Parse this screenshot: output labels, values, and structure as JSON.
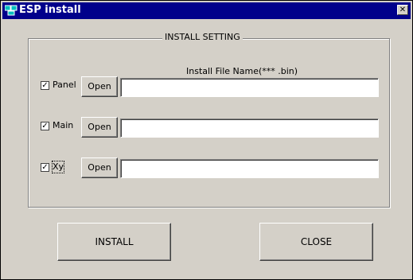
{
  "window": {
    "title": "ESP install"
  },
  "group": {
    "title": "INSTALL SETTING"
  },
  "column_header": "Install File Name(*** .bin)",
  "rows": [
    {
      "label": "Panel",
      "checked": true,
      "open_label": "Open",
      "value": ""
    },
    {
      "label": "Main",
      "checked": true,
      "open_label": "Open",
      "value": ""
    },
    {
      "label": "Xy",
      "checked": true,
      "open_label": "Open",
      "value": ""
    }
  ],
  "checkbox_mark": "✓",
  "buttons": {
    "install": "INSTALL",
    "close": "CLOSE"
  },
  "titlebar": {
    "close_glyph": "✕"
  },
  "colors": {
    "titlebar": "#00008b",
    "face": "#d4d0c8"
  }
}
